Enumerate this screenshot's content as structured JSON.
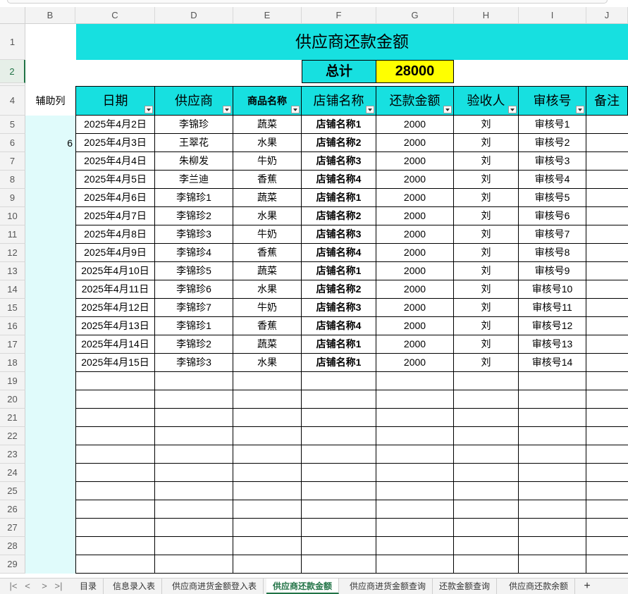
{
  "columns": [
    "B",
    "C",
    "D",
    "E",
    "F",
    "G",
    "H",
    "I",
    "J"
  ],
  "rows": [
    "1",
    "2",
    "",
    "4",
    "5",
    "6",
    "7",
    "8",
    "9",
    "10",
    "11",
    "12",
    "13",
    "14",
    "15",
    "16",
    "17",
    "18",
    "19",
    "20",
    "21",
    "22",
    "23",
    "24",
    "25",
    "26",
    "27",
    "28",
    "29"
  ],
  "title": "供应商还款金额",
  "total": {
    "label": "总计",
    "value": "28000"
  },
  "aux": {
    "header": "辅助列",
    "value": "6"
  },
  "headers": [
    "日期",
    "供应商",
    "商品名称",
    "店铺名称",
    "还款金额",
    "验收人",
    "审核号",
    "备注"
  ],
  "records": [
    [
      "2025年4月2日",
      "李锦珍",
      "蔬菜",
      "店铺名称1",
      "2000",
      "刘",
      "审核号1",
      ""
    ],
    [
      "2025年4月3日",
      "王翠花",
      "水果",
      "店铺名称2",
      "2000",
      "刘",
      "审核号2",
      ""
    ],
    [
      "2025年4月4日",
      "朱柳发",
      "牛奶",
      "店铺名称3",
      "2000",
      "刘",
      "审核号3",
      ""
    ],
    [
      "2025年4月5日",
      "李兰迪",
      "香蕉",
      "店铺名称4",
      "2000",
      "刘",
      "审核号4",
      ""
    ],
    [
      "2025年4月6日",
      "李锦珍1",
      "蔬菜",
      "店铺名称1",
      "2000",
      "刘",
      "审核号5",
      ""
    ],
    [
      "2025年4月7日",
      "李锦珍2",
      "水果",
      "店铺名称2",
      "2000",
      "刘",
      "审核号6",
      ""
    ],
    [
      "2025年4月8日",
      "李锦珍3",
      "牛奶",
      "店铺名称3",
      "2000",
      "刘",
      "审核号7",
      ""
    ],
    [
      "2025年4月9日",
      "李锦珍4",
      "香蕉",
      "店铺名称4",
      "2000",
      "刘",
      "审核号8",
      ""
    ],
    [
      "2025年4月10日",
      "李锦珍5",
      "蔬菜",
      "店铺名称1",
      "2000",
      "刘",
      "审核号9",
      ""
    ],
    [
      "2025年4月11日",
      "李锦珍6",
      "水果",
      "店铺名称2",
      "2000",
      "刘",
      "审核号10",
      ""
    ],
    [
      "2025年4月12日",
      "李锦珍7",
      "牛奶",
      "店铺名称3",
      "2000",
      "刘",
      "审核号11",
      ""
    ],
    [
      "2025年4月13日",
      "李锦珍1",
      "香蕉",
      "店铺名称4",
      "2000",
      "刘",
      "审核号12",
      ""
    ],
    [
      "2025年4月14日",
      "李锦珍2",
      "蔬菜",
      "店铺名称1",
      "2000",
      "刘",
      "审核号13",
      ""
    ],
    [
      "2025年4月15日",
      "李锦珍3",
      "水果",
      "店铺名称1",
      "2000",
      "刘",
      "审核号14",
      ""
    ]
  ],
  "empty_rows": 11,
  "sheets": [
    "目录",
    "信息录入表",
    "供应商进货金额登入表",
    "供应商还款金额",
    "供应商进货金额查询",
    "还款金额查询",
    "供应商还款余额"
  ],
  "active_sheet": "供应商还款金额",
  "nav": [
    "|<",
    "<",
    ">",
    ">|"
  ],
  "add_sheet": "+",
  "colors": {
    "accent": "#17e0e0",
    "total_bg": "#ffff00",
    "aux_bg": "#e0fbfb",
    "active_tab": "#217346"
  }
}
